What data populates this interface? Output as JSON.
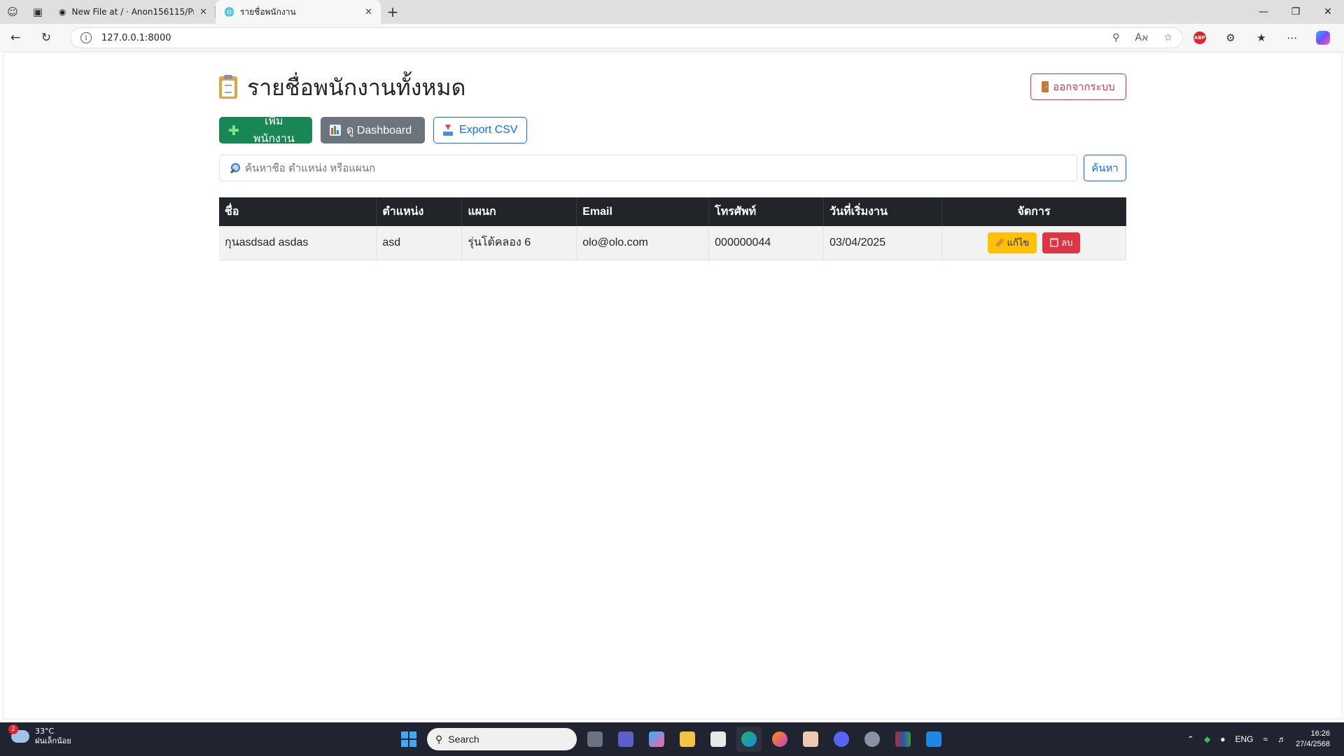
{
  "browser": {
    "tabs": [
      {
        "title": "New File at / · Anon156115/Projec",
        "icon": "github-icon",
        "active": false
      },
      {
        "title": "รายชื่อพนักงาน",
        "icon": "globe-icon",
        "active": true
      }
    ],
    "url": "127.0.0.1:8000"
  },
  "page": {
    "title": "รายชื่อพนักงานทั้งหมด",
    "logout_label": "ออกจากระบบ",
    "actions": {
      "add_employee": "เพิ่มพนักงาน",
      "dashboard": "ดู Dashboard",
      "export_csv": "Export CSV"
    },
    "search": {
      "placeholder": "ค้นหาชื่อ ตำแหน่ง หรือแผนก",
      "button": "ค้นหา"
    },
    "table": {
      "headers": [
        "ชื่อ",
        "ตำแหน่ง",
        "แผนก",
        "Email",
        "โทรศัพท์",
        "วันที่เริ่มงาน",
        "จัดการ"
      ],
      "rows": [
        {
          "name": "กุนasdsad asdas",
          "position": "asd",
          "department": "รุ่นโต้คลอง 6",
          "email": "olo@olo.com",
          "phone": "000000044",
          "start_date": "03/04/2025",
          "edit_label": "แก้ไข",
          "delete_label": "ลบ"
        }
      ]
    }
  },
  "taskbar": {
    "weather": {
      "temp": "33°C",
      "condition": "ฝนเล็กน้อย",
      "badge": "2"
    },
    "search_label": "Search",
    "tray": {
      "language": "ENG",
      "time": "16:26",
      "date": "27/4/2568"
    }
  },
  "colors": {
    "primary": "#0d6efd",
    "success": "#198754",
    "secondary": "#6c757d",
    "danger": "#dc3545",
    "warning": "#ffc107",
    "table_header": "#212529"
  }
}
